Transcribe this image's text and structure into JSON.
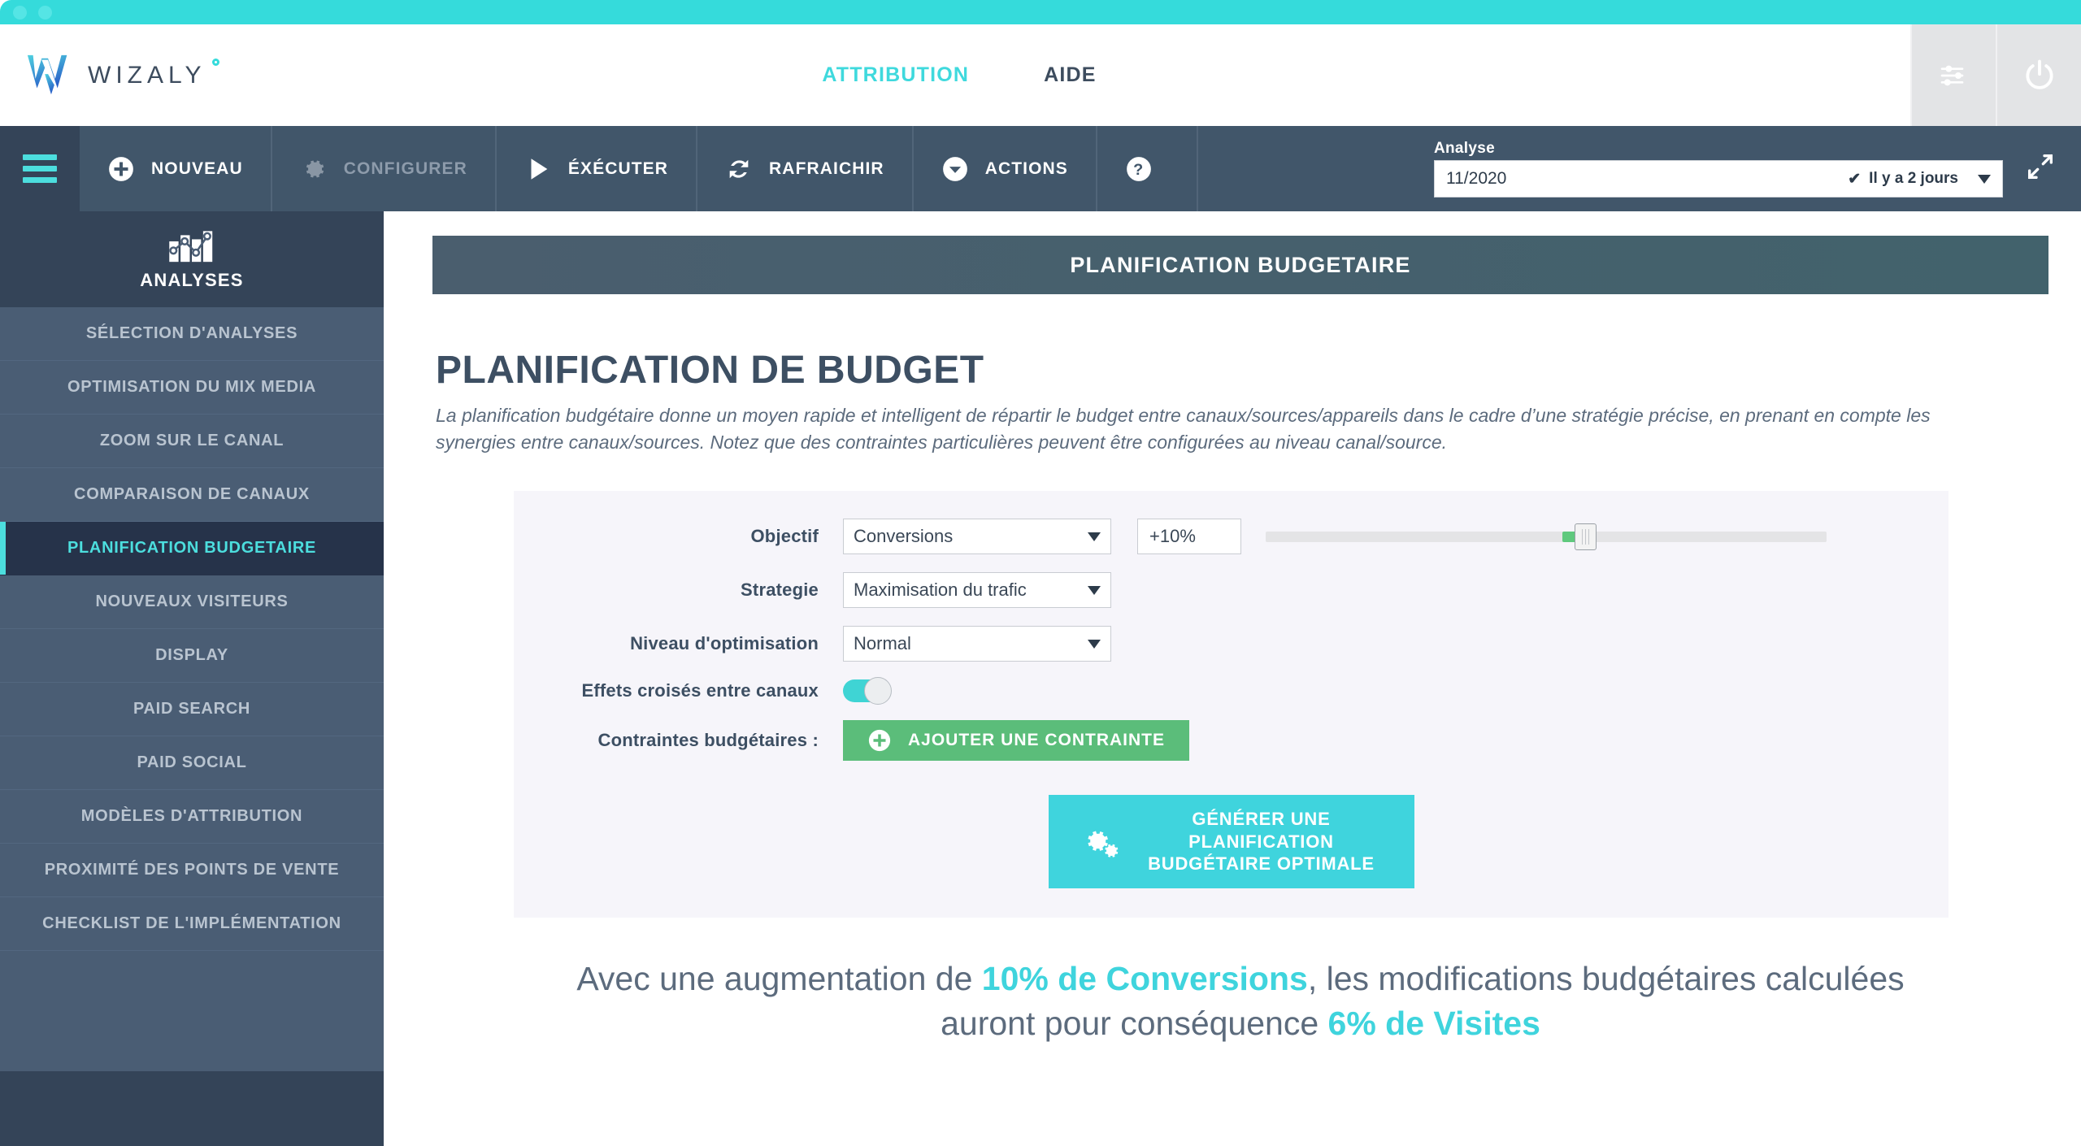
{
  "window": {
    "accent_teal": "#35dbdb",
    "dots": [
      "dot-1",
      "dot-2"
    ]
  },
  "header": {
    "logo_text": "WIZALY",
    "tabs": [
      {
        "label": "ATTRIBUTION",
        "active": true
      },
      {
        "label": "AIDE",
        "active": false
      }
    ],
    "icons": [
      {
        "name": "settings-sliders-icon"
      },
      {
        "name": "power-icon"
      }
    ]
  },
  "toolbar": {
    "menu_icon": "hamburger-icon",
    "buttons": [
      {
        "label": "NOUVEAU",
        "icon": "plus-circle-icon",
        "disabled": false
      },
      {
        "label": "CONFIGURER",
        "icon": "gear-icon",
        "disabled": true
      },
      {
        "label": "ÉXÉCUTER",
        "icon": "play-icon",
        "disabled": false
      },
      {
        "label": "RAFRAICHIR",
        "icon": "refresh-icon",
        "disabled": false
      },
      {
        "label": "ACTIONS",
        "icon": "chevron-down-circle-icon",
        "disabled": false
      },
      {
        "label": "",
        "icon": "help-circle-icon",
        "disabled": false
      }
    ],
    "analysis": {
      "label": "Analyse",
      "value": "11/2020",
      "check": "✔",
      "ago": "Il y a 2 jours"
    },
    "expand_icon": "expand-arrows-icon"
  },
  "sidebar": {
    "section_label": "ANALYSES",
    "section_icon": "bar-chart-icon",
    "items": [
      {
        "label": "SÉLECTION D'ANALYSES",
        "active": false
      },
      {
        "label": "OPTIMISATION DU MIX MEDIA",
        "active": false
      },
      {
        "label": "ZOOM SUR LE CANAL",
        "active": false
      },
      {
        "label": "COMPARAISON DE CANAUX",
        "active": false
      },
      {
        "label": "PLANIFICATION BUDGETAIRE",
        "active": true
      },
      {
        "label": "NOUVEAUX VISITEURS",
        "active": false
      },
      {
        "label": "DISPLAY",
        "active": false
      },
      {
        "label": "PAID SEARCH",
        "active": false
      },
      {
        "label": "PAID SOCIAL",
        "active": false
      },
      {
        "label": "MODÈLES D'ATTRIBUTION",
        "active": false
      },
      {
        "label": "PROXIMITÉ DES POINTS DE VENTE",
        "active": false
      },
      {
        "label": "CHECKLIST DE L'IMPLÉMENTATION",
        "active": false
      }
    ]
  },
  "main": {
    "panel_title": "PLANIFICATION BUDGETAIRE",
    "page_title": "PLANIFICATION DE BUDGET",
    "description": "La planification budgétaire donne un moyen rapide et intelligent de répartir le budget entre canaux/sources/appareils dans le cadre d’une stratégie précise, en prenant en compte les synergies entre canaux/sources. Notez que des contraintes particulières peuvent être configurées au niveau canal/source.",
    "form": {
      "objectif": {
        "label": "Objectif",
        "value": "Conversions"
      },
      "percent": {
        "value": "+10%",
        "slider_position_pct": 57
      },
      "strategie": {
        "label": "Strategie",
        "value": "Maximisation du trafic"
      },
      "niveau": {
        "label": "Niveau d'optimisation",
        "value": "Normal"
      },
      "effets": {
        "label": "Effets croisés entre canaux",
        "enabled": true
      },
      "contraintes": {
        "label": "Contraintes budgétaires :",
        "button_label": "AJOUTER UNE CONTRAINTE",
        "button_icon": "plus-circle-icon"
      },
      "generate": {
        "line1": "GÉNÉRER UNE PLANIFICATION",
        "line2": "BUDGÉTAIRE OPTIMALE",
        "icon": "gears-icon"
      }
    },
    "summary": {
      "part1": "Avec une augmentation de ",
      "highlight1": "10% de Conversions",
      "part2": ", les modifications budgétaires calculées auront pour conséquence ",
      "highlight2": "6% de Visites"
    }
  }
}
